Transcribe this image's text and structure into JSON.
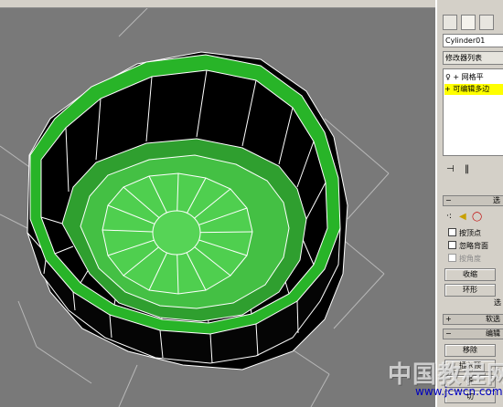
{
  "panel": {
    "object_name": "Cylinder01",
    "modifier_list_label": "修改器列表",
    "stack_items": [
      {
        "label": "网格平",
        "expand": "+",
        "state": "normal"
      },
      {
        "label": "可编辑多边",
        "expand": "+",
        "state": "selected"
      }
    ],
    "selection_rollout_title": "选",
    "selection_checkboxes": [
      {
        "label": "按顶点",
        "checked": false,
        "enabled": true
      },
      {
        "label": "忽略背面",
        "checked": false,
        "enabled": true
      },
      {
        "label": "按角度",
        "checked": false,
        "enabled": false
      }
    ],
    "shrink_button": "收缩",
    "ring_button": "环形",
    "selection_footer": "选",
    "soft_rollout_title": "软选",
    "edit_rollout_title": "编辑",
    "remove_button": "移除",
    "insert_button": "插入顶",
    "weld_button": "焊",
    "extra_button": "切",
    "stack_icons": [
      "pin-icon",
      "show-end-result-icon"
    ],
    "tab_icons": [
      "create-tab-icon",
      "modify-tab-icon",
      "hierarchy-tab-icon"
    ]
  },
  "viewport": {
    "inner_polygon_color": "#00c000",
    "rim_color": "#2fbf2f",
    "wall_color": "#000000",
    "background_color": "#797979"
  },
  "watermark": {
    "text": "中国教程网",
    "url": "www.jcwcn.com"
  },
  "colors": {
    "panel_bg": "#d4d0c8",
    "selected_row": "#ffff00",
    "watermark_url": "#0000c0"
  }
}
